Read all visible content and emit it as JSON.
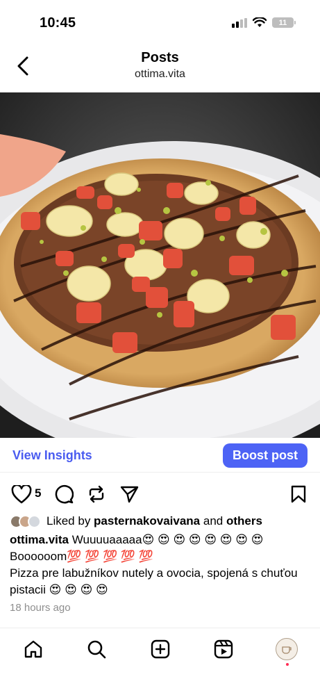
{
  "status": {
    "time": "10:45",
    "battery": "11"
  },
  "header": {
    "title": "Posts",
    "username": "ottima.vita"
  },
  "actions": {
    "insights": "View Insights",
    "boost": "Boost post"
  },
  "post": {
    "like_count": "5",
    "liked_by_prefix": "Liked by ",
    "liked_by_user": "pasternakovaivana",
    "liked_by_mid": " and ",
    "liked_by_others": "others",
    "caption_user": "ottima.vita",
    "caption_line1": " Wuuuuaaaaa😍 😍 😍 😍 😍 😍 😍 😍",
    "caption_line2": "Boooooom💯 💯 💯 💯 💯",
    "caption_line3": "Pizza pre labužníkov nutely a ovocia, spojená s chuťou pistacii 😍 😍 😍 😍",
    "time_ago": "18 hours ago"
  },
  "colors": {
    "accent": "#4d63f5",
    "link": "#4a5cf0"
  },
  "icons": [
    "back-icon",
    "heart-icon",
    "comment-icon",
    "repost-icon",
    "share-icon",
    "bookmark-icon",
    "home-icon",
    "search-icon",
    "create-icon",
    "reels-icon"
  ]
}
